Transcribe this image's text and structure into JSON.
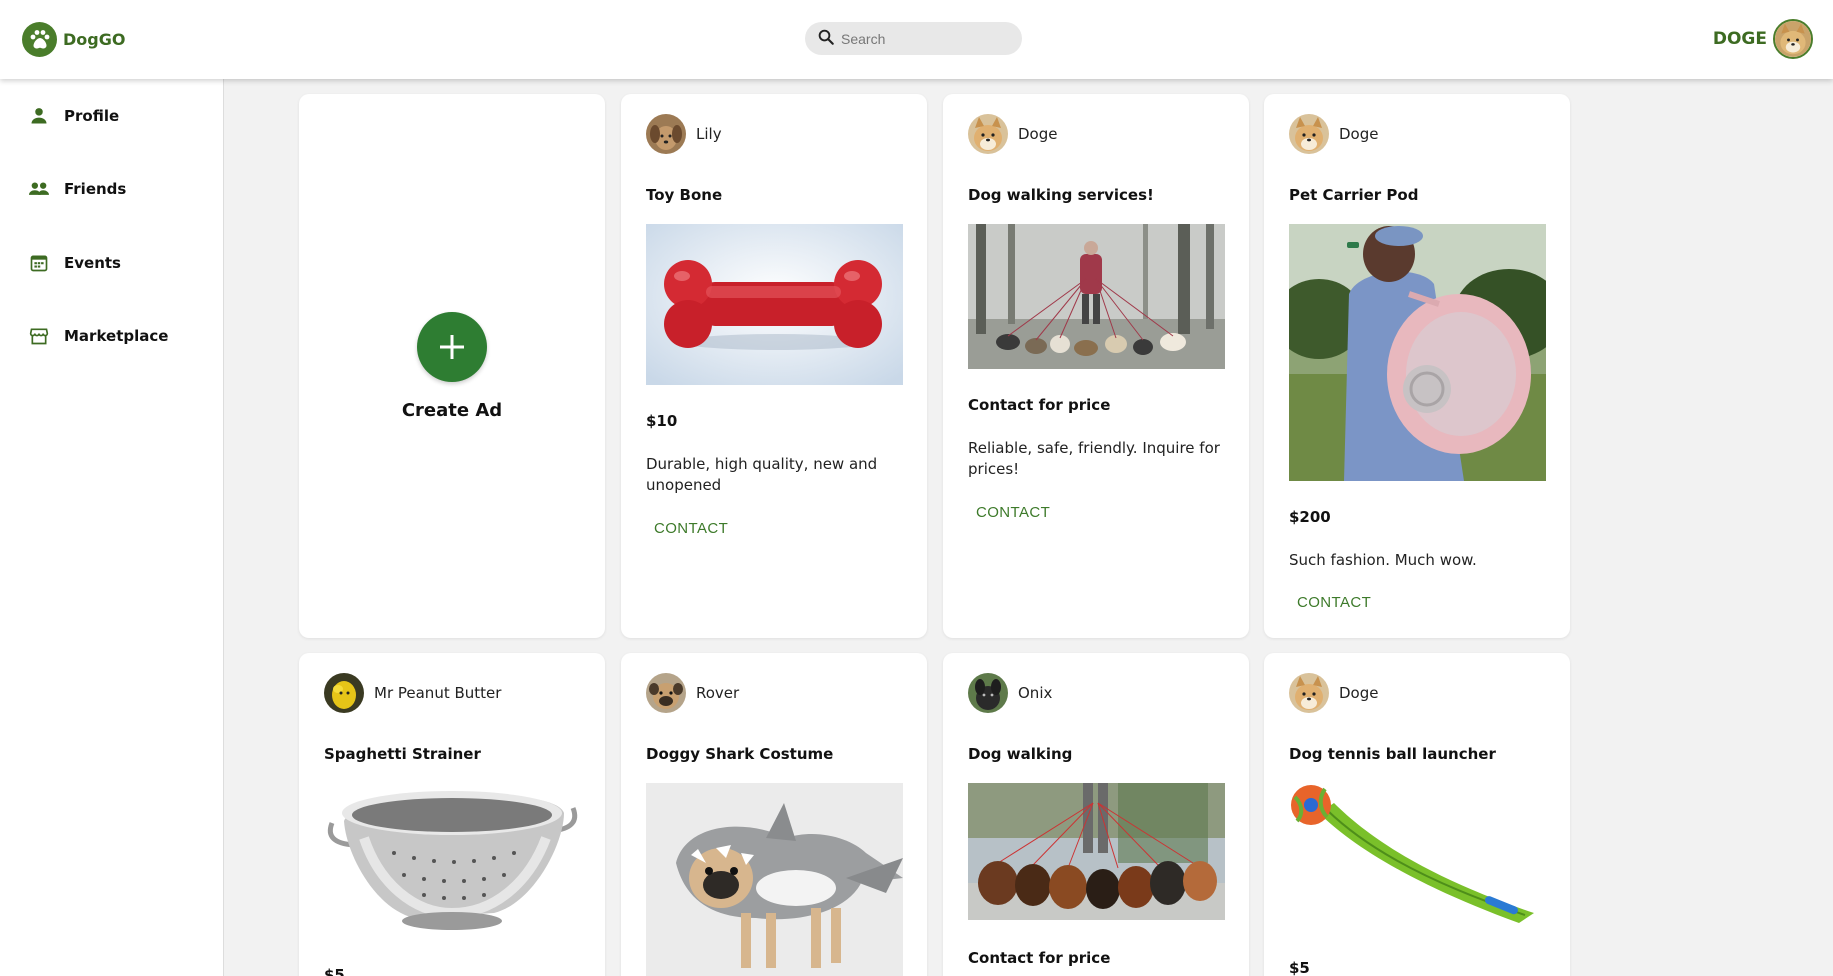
{
  "app": {
    "name": "DogGO",
    "accent": "#3d6b22",
    "contact_color": "#3d7a2a",
    "create_color": "#2e7d32"
  },
  "search": {
    "placeholder": "Search"
  },
  "user": {
    "name": "DOGE"
  },
  "sidebar": {
    "items": [
      {
        "label": "Profile",
        "icon": "person-icon"
      },
      {
        "label": "Friends",
        "icon": "people-icon"
      },
      {
        "label": "Events",
        "icon": "calendar-icon"
      },
      {
        "label": "Marketplace",
        "icon": "storefront-icon"
      }
    ]
  },
  "create_ad": {
    "label": "Create Ad"
  },
  "ads": [
    {
      "user": "Lily",
      "title": "Toy Bone",
      "price": "$10",
      "description": "Durable, high quality, new and unopened",
      "contact": "CONTACT",
      "image": "red rubber bone toy"
    },
    {
      "user": "Doge",
      "title": "Dog walking services!",
      "price": "Contact for price",
      "description": "Reliable, safe, friendly. Inquire for prices!",
      "contact": "CONTACT",
      "image": "person walking many dogs in foggy park"
    },
    {
      "user": "Doge",
      "title": "Pet Carrier Pod",
      "price": "$200",
      "description": "Such fashion. Much wow.",
      "contact": "CONTACT",
      "image": "person wearing pink pet backpack"
    },
    {
      "user": "Mr Peanut Butter",
      "title": "Spaghetti Strainer",
      "price": "$5",
      "image": "stainless steel colander"
    },
    {
      "user": "Rover",
      "title": "Doggy Shark Costume",
      "image": "pug in shark costume"
    },
    {
      "user": "Onix",
      "title": "Dog walking",
      "price": "Contact for price",
      "image": "group of dachshunds on leashes"
    },
    {
      "user": "Doge",
      "title": "Dog tennis ball launcher",
      "price": "$5",
      "image": "green ball launcher with orange ball"
    }
  ]
}
